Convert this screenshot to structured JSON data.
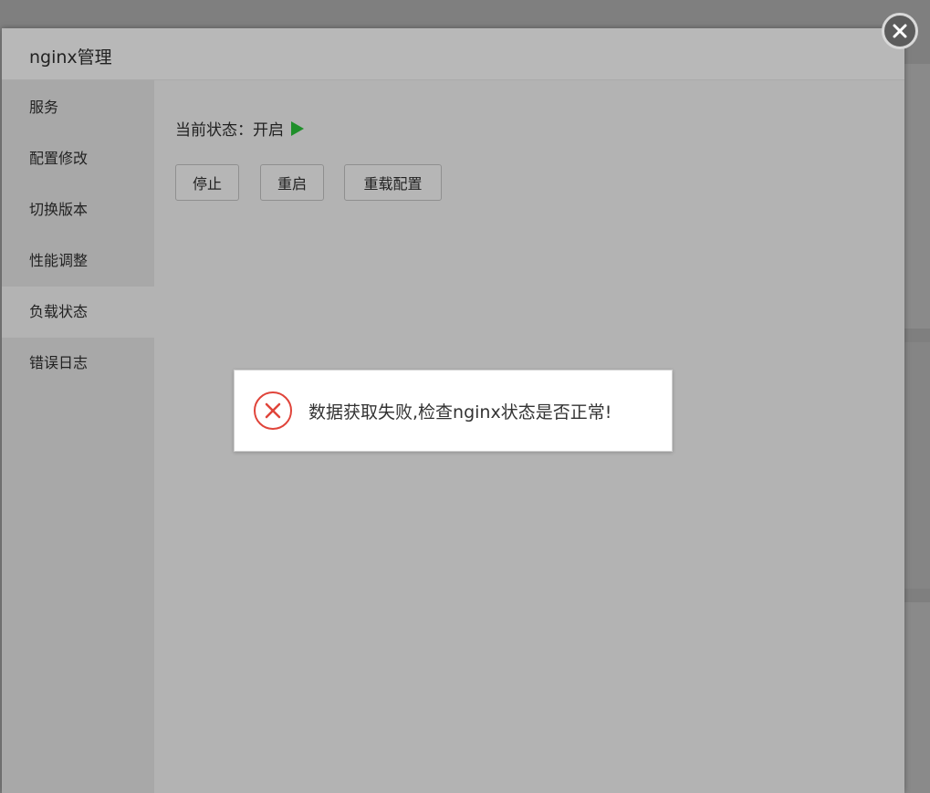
{
  "dialog": {
    "title": "nginx管理",
    "close_icon": "close-icon"
  },
  "sidebar": {
    "items": [
      {
        "label": "服务",
        "active": false
      },
      {
        "label": "配置修改",
        "active": false
      },
      {
        "label": "切换版本",
        "active": false
      },
      {
        "label": "性能调整",
        "active": false
      },
      {
        "label": "负载状态",
        "active": true
      },
      {
        "label": "错误日志",
        "active": false
      }
    ]
  },
  "content": {
    "status_label": "当前状态：",
    "status_value": "开启",
    "status_icon": "play-icon",
    "status_color": "#1f8f2a",
    "buttons": {
      "stop": "停止",
      "restart": "重启",
      "reload": "重载配置"
    }
  },
  "toast": {
    "icon": "error-icon",
    "icon_color": "#e0443a",
    "message": "数据获取失败,检查nginx状态是否正常!"
  }
}
